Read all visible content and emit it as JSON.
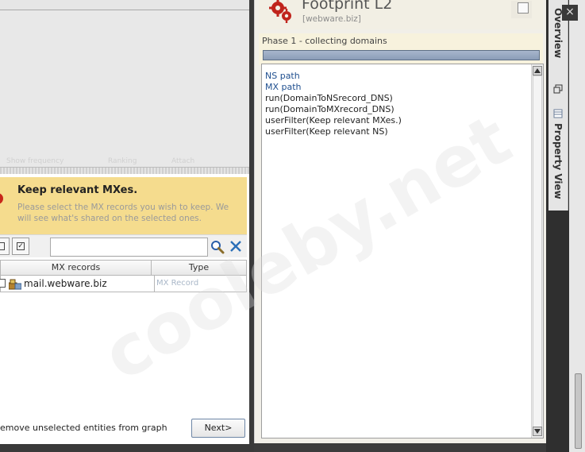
{
  "left": {
    "ghost_labels": [
      "Show frequency",
      "Ranking",
      "Attach"
    ],
    "notice": {
      "title": "Keep relevant MXes.",
      "desc": "Please select the MX records you wish to keep. We will see what's shared on the selected ones."
    },
    "toolbar": {
      "select_all_check": "✓",
      "search_value": ""
    },
    "table": {
      "headers": [
        "MX records",
        "Type"
      ],
      "rows": [
        {
          "name": "mail.webware.biz",
          "type": "MX Record"
        }
      ]
    },
    "footer": {
      "text": "emove unselected entities from graph",
      "next_label": "Next>"
    }
  },
  "right": {
    "title": "Footprint L2",
    "subtitle": "[webware.biz]",
    "phase": "Phase 1 - collecting domains",
    "progress": 1.0,
    "log": [
      {
        "text": "NS path",
        "style": "blue"
      },
      {
        "text": "MX path",
        "style": "blue"
      },
      {
        "text": "run(DomainToNSrecord_DNS)",
        "style": "plain"
      },
      {
        "text": "run(DomainToMXrecord_DNS)",
        "style": "plain"
      },
      {
        "text": "userFilter(Keep relevant MXes.)",
        "style": "plain"
      },
      {
        "text": "userFilter(Keep relevant NS)",
        "style": "plain"
      }
    ]
  },
  "side": {
    "tab_overview": "Overview",
    "tab_property": "Property View",
    "close_glyph": "×"
  },
  "watermark": "cooleby.net",
  "colors": {
    "notice_bg": "#f5dc8e",
    "link_blue": "#1f4f8f",
    "progress": "#8b9db8"
  }
}
